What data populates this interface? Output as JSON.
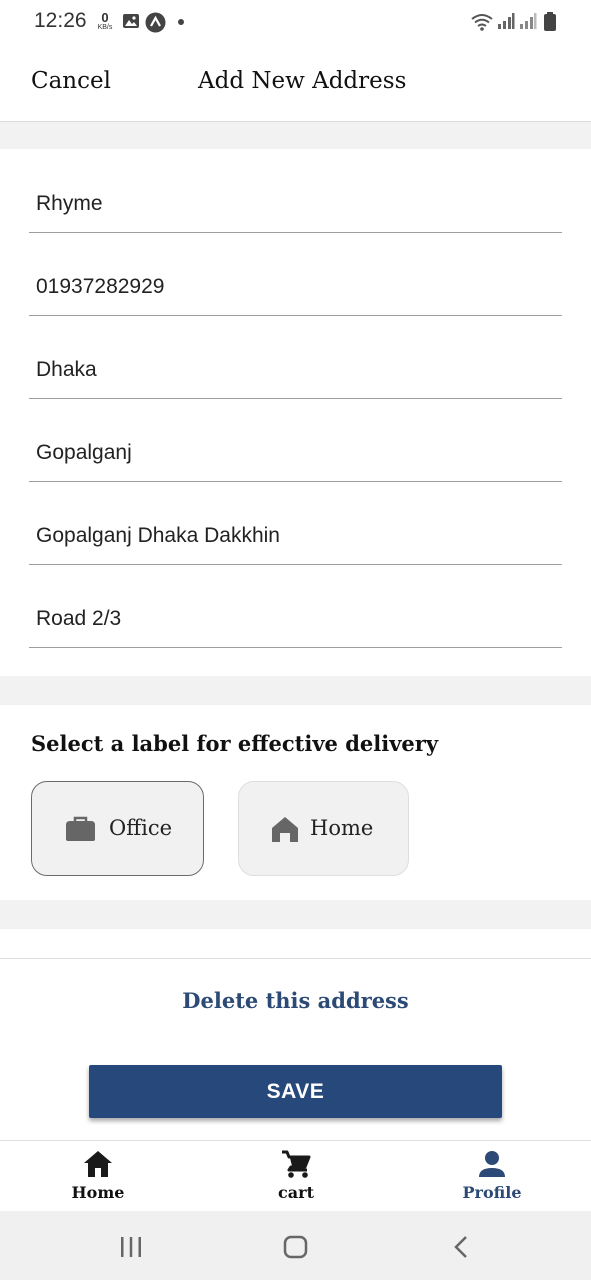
{
  "status_bar": {
    "time": "12:26",
    "net_speed_value": "0",
    "net_speed_unit": "KB/s"
  },
  "header": {
    "cancel_label": "Cancel",
    "title": "Add New Address"
  },
  "form": {
    "name": "Rhyme",
    "phone": "01937282929",
    "division": "Dhaka",
    "district": "Gopalganj",
    "area": "Gopalganj Dhaka Dakkhin",
    "address": "Road 2/3"
  },
  "label_section": {
    "heading": "Select a label for effective delivery",
    "options": [
      {
        "label": "Office",
        "icon": "briefcase-icon",
        "selected": true
      },
      {
        "label": "Home",
        "icon": "home-icon",
        "selected": false
      }
    ]
  },
  "actions": {
    "delete_label": "Delete this address",
    "save_label": "SAVE"
  },
  "bottom_nav": {
    "items": [
      {
        "label": "Home",
        "icon": "home-icon"
      },
      {
        "label": "cart",
        "icon": "cart-icon"
      },
      {
        "label": "Profile",
        "icon": "person-icon",
        "active": true
      }
    ]
  },
  "colors": {
    "primary": "#27487a",
    "active_nav": "#2c4a75",
    "band": "#f2f2f2"
  }
}
